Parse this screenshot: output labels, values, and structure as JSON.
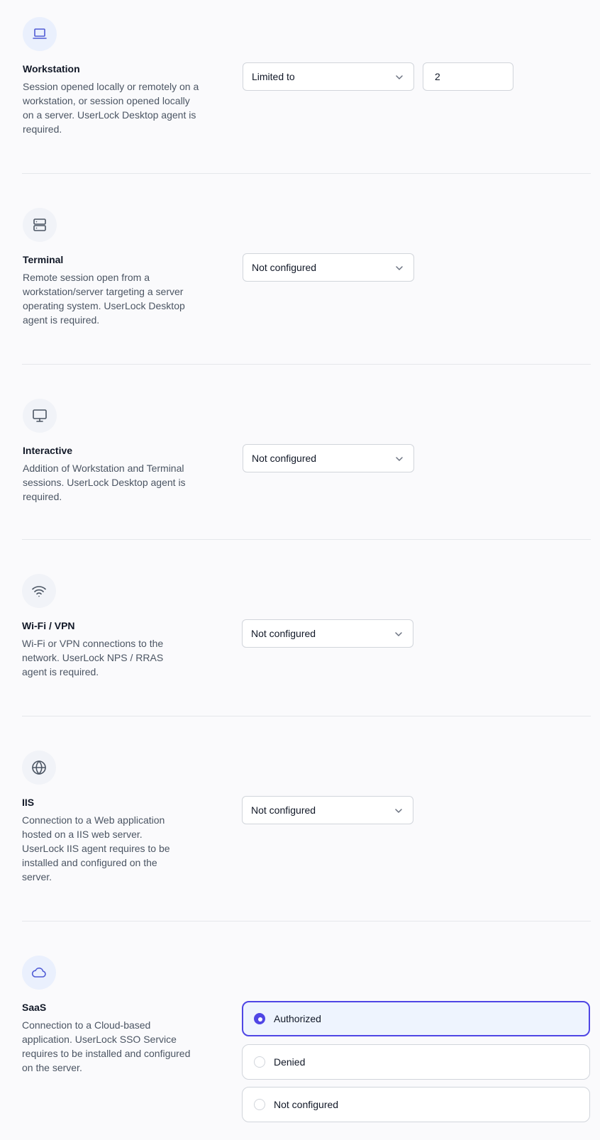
{
  "colors": {
    "accent": "#4f46e5",
    "icon_accent": "#4f5bd5",
    "icon_gray": "#4b5563"
  },
  "workstation": {
    "icon": "laptop-icon",
    "title": "Workstation",
    "description": "Session opened locally or remotely on a workstation, or session opened locally on a server. UserLock Desktop agent is required.",
    "select_value": "Limited to",
    "limit_value": "2"
  },
  "terminal": {
    "icon": "server-icon",
    "title": "Terminal",
    "description": "Remote session open from a workstation/server targeting a server operating system. UserLock Desktop agent is required.",
    "select_value": "Not configured"
  },
  "interactive": {
    "icon": "monitor-icon",
    "title": "Interactive",
    "description": "Addition of Workstation and Terminal sessions. UserLock Desktop agent is required.",
    "select_value": "Not configured"
  },
  "wifi_vpn": {
    "icon": "wifi-icon",
    "title": "Wi-Fi / VPN",
    "description": "Wi-Fi or VPN connections to the network. UserLock NPS / RRAS agent is required.",
    "select_value": "Not configured"
  },
  "iis": {
    "icon": "globe-icon",
    "title": "IIS",
    "description": "Connection to a Web application hosted on a IIS web server. UserLock IIS agent requires to be installed and configured on the server.",
    "select_value": "Not configured"
  },
  "saas": {
    "icon": "cloud-icon",
    "title": "SaaS",
    "description": "Connection to a Cloud-based application. UserLock SSO Service requires to be installed and configured on the server.",
    "options": [
      "Authorized",
      "Denied",
      "Not configured"
    ],
    "selected": "Authorized"
  }
}
